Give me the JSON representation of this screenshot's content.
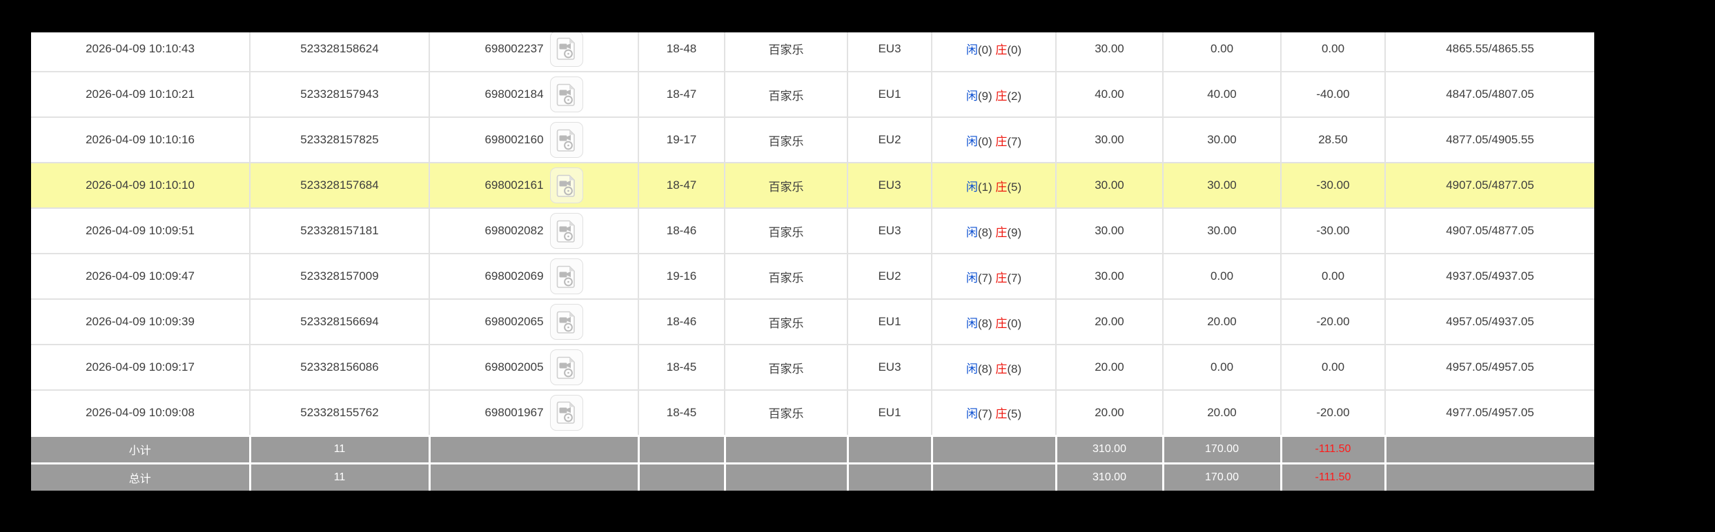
{
  "colors": {
    "bet_blue": "#0b63e5",
    "player_blue": "#0b4fd1",
    "banker_red": "#ee150c",
    "loss_red": "#f00c0c",
    "highlight_yellow": "#fafaa4",
    "footer_gray": "#9b9b9b",
    "footer_red": "#ff1a1a"
  },
  "labels": {
    "player": "闲",
    "banker": "庄"
  },
  "table": {
    "rows": [
      {
        "time": "2026-04-09 10:10:43",
        "bet_id": "523328158624",
        "round_id": "698002237",
        "shoe": "18-48",
        "game": "百家乐",
        "table": "EU3",
        "player": "0",
        "banker": "0",
        "bet": "30.00",
        "valid": "0.00",
        "winloss": "0.00",
        "balance": "4865.55/4865.55",
        "highlighted": false
      },
      {
        "time": "2026-04-09 10:10:21",
        "bet_id": "523328157943",
        "round_id": "698002184",
        "shoe": "18-47",
        "game": "百家乐",
        "table": "EU1",
        "player": "9",
        "banker": "2",
        "bet": "40.00",
        "valid": "40.00",
        "winloss": "-40.00",
        "balance": "4847.05/4807.05",
        "highlighted": false
      },
      {
        "time": "2026-04-09 10:10:16",
        "bet_id": "523328157825",
        "round_id": "698002160",
        "shoe": "19-17",
        "game": "百家乐",
        "table": "EU2",
        "player": "0",
        "banker": "7",
        "bet": "30.00",
        "valid": "30.00",
        "winloss": "28.50",
        "balance": "4877.05/4905.55",
        "highlighted": false
      },
      {
        "time": "2026-04-09 10:10:10",
        "bet_id": "523328157684",
        "round_id": "698002161",
        "shoe": "18-47",
        "game": "百家乐",
        "table": "EU3",
        "player": "1",
        "banker": "5",
        "bet": "30.00",
        "valid": "30.00",
        "winloss": "-30.00",
        "balance": "4907.05/4877.05",
        "highlighted": true
      },
      {
        "time": "2026-04-09 10:09:51",
        "bet_id": "523328157181",
        "round_id": "698002082",
        "shoe": "18-46",
        "game": "百家乐",
        "table": "EU3",
        "player": "8",
        "banker": "9",
        "bet": "30.00",
        "valid": "30.00",
        "winloss": "-30.00",
        "balance": "4907.05/4877.05",
        "highlighted": false
      },
      {
        "time": "2026-04-09 10:09:47",
        "bet_id": "523328157009",
        "round_id": "698002069",
        "shoe": "19-16",
        "game": "百家乐",
        "table": "EU2",
        "player": "7",
        "banker": "7",
        "bet": "30.00",
        "valid": "0.00",
        "winloss": "0.00",
        "balance": "4937.05/4937.05",
        "highlighted": false
      },
      {
        "time": "2026-04-09 10:09:39",
        "bet_id": "523328156694",
        "round_id": "698002065",
        "shoe": "18-46",
        "game": "百家乐",
        "table": "EU1",
        "player": "8",
        "banker": "0",
        "bet": "20.00",
        "valid": "20.00",
        "winloss": "-20.00",
        "balance": "4957.05/4937.05",
        "highlighted": false
      },
      {
        "time": "2026-04-09 10:09:17",
        "bet_id": "523328156086",
        "round_id": "698002005",
        "shoe": "18-45",
        "game": "百家乐",
        "table": "EU3",
        "player": "8",
        "banker": "8",
        "bet": "20.00",
        "valid": "0.00",
        "winloss": "0.00",
        "balance": "4957.05/4957.05",
        "highlighted": false
      },
      {
        "time": "2026-04-09 10:09:08",
        "bet_id": "523328155762",
        "round_id": "698001967",
        "shoe": "18-45",
        "game": "百家乐",
        "table": "EU1",
        "player": "7",
        "banker": "5",
        "bet": "20.00",
        "valid": "20.00",
        "winloss": "-20.00",
        "balance": "4977.05/4957.05",
        "highlighted": false
      }
    ],
    "footer": {
      "subtotal": {
        "label": "小计",
        "count": "11",
        "bet": "310.00",
        "valid": "170.00",
        "winloss": "-111.50"
      },
      "total": {
        "label": "总计",
        "count": "11",
        "bet": "310.00",
        "valid": "170.00",
        "winloss": "-111.50"
      }
    }
  }
}
